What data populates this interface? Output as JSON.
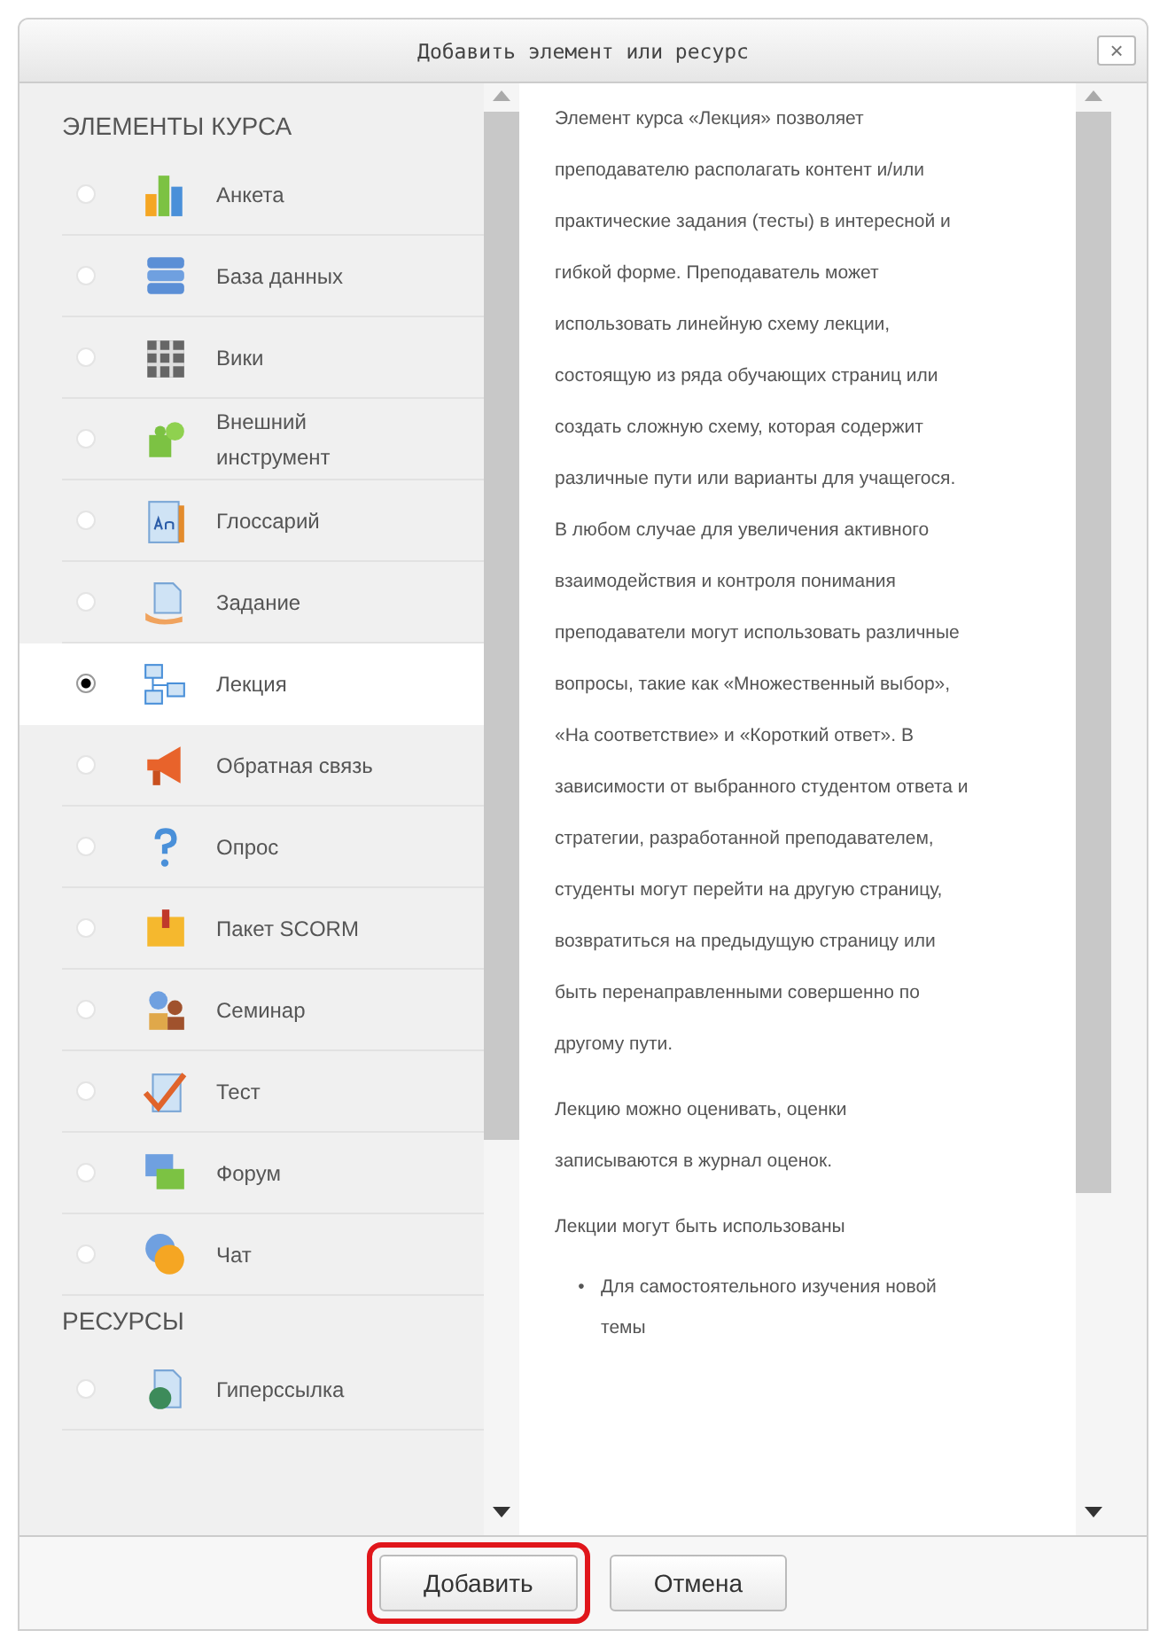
{
  "dialog": {
    "title": "Добавить элемент или ресурс",
    "close": "×"
  },
  "groups": [
    {
      "heading": "ЭЛЕМЕНТЫ КУРСА",
      "items": [
        {
          "label": "Анкета",
          "selected": false
        },
        {
          "label": "База данных",
          "selected": false
        },
        {
          "label": "Вики",
          "selected": false
        },
        {
          "label": "Внешний инструмент",
          "selected": false
        },
        {
          "label": "Глоссарий",
          "selected": false
        },
        {
          "label": "Задание",
          "selected": false
        },
        {
          "label": "Лекция",
          "selected": true
        },
        {
          "label": "Обратная связь",
          "selected": false
        },
        {
          "label": "Опрос",
          "selected": false
        },
        {
          "label": "Пакет SCORM",
          "selected": false
        },
        {
          "label": "Семинар",
          "selected": false
        },
        {
          "label": "Тест",
          "selected": false
        },
        {
          "label": "Форум",
          "selected": false
        },
        {
          "label": "Чат",
          "selected": false
        }
      ]
    },
    {
      "heading": "РЕСУРСЫ",
      "items": [
        {
          "label": "Гиперссылка",
          "selected": false
        }
      ]
    }
  ],
  "description": [
    {
      "kind": "paragraph",
      "text": "Элемент курса «Лекция» позволяет преподавателю располагать контент и/или практические задания (тесты) в интересной и гибкой форме. Преподаватель может использовать линейную схему лекции, состоящую из ряда обучающих страниц или создать сложную схему, которая содержит различные пути или варианты для учащегося. В любом случае для увеличения активного взаимодействия и контроля понимания преподаватели могут использовать различные вопросы, такие как «Множественный выбор», «На соответствие» и «Короткий ответ». В зависимости от выбранного студентом ответа и стратегии, разработанной преподавателем, студенты могут перейти на другую страницу, возвратиться на предыдущую страницу или быть перенаправленными совершенно по другому пути."
    },
    {
      "kind": "paragraph",
      "text": "Лекцию можно оценивать, оценки записываются в журнал оценок."
    },
    {
      "kind": "paragraph",
      "text": "Лекции могут быть использованы"
    },
    {
      "kind": "bullet",
      "bullet": "•",
      "text": "Для самостоятельного изучения новой темы"
    }
  ],
  "buttons": [
    {
      "label": "Добавить",
      "highlighted": true
    },
    {
      "label": "Отмена",
      "highlighted": false
    }
  ]
}
